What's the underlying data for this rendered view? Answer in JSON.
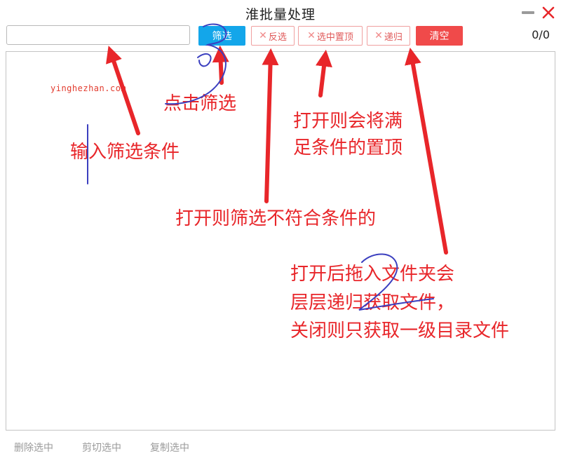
{
  "window": {
    "title": "淮批量处理",
    "minimize_icon": "minimize-icon",
    "close_icon": "close-icon",
    "close_color": "#e8262a"
  },
  "toolbar": {
    "search_value": "",
    "search_placeholder": "",
    "filter_label": "筛选",
    "invert_label": "反选",
    "pin_label": "选中置顶",
    "recursive_label": "递归",
    "clear_label": "清空",
    "counter": "0/0",
    "toggle_icon": "x-icon",
    "colors": {
      "filter": "#13a6ea",
      "clear": "#f04a4a",
      "toggle_text": "#e05a5a"
    }
  },
  "footer": {
    "delete_label": "删除选中",
    "cut_label": "剪切选中",
    "copy_label": "复制选中"
  },
  "annotations": {
    "watermark": "yinghezhan.com",
    "click_filter": "点击筛选",
    "input_condition": "输入筛选条件",
    "pin_note": [
      "打开则会将满",
      "足条件的置顶"
    ],
    "invert_note": "打开则筛选不符合条件的",
    "recursive_note": [
      "打开后拖入文件夹会",
      "层层递归获取文件，",
      "关闭则只获取一级目录文件"
    ],
    "annotation_color": "#e8262a",
    "scribble_color": "#3b3fbf"
  }
}
